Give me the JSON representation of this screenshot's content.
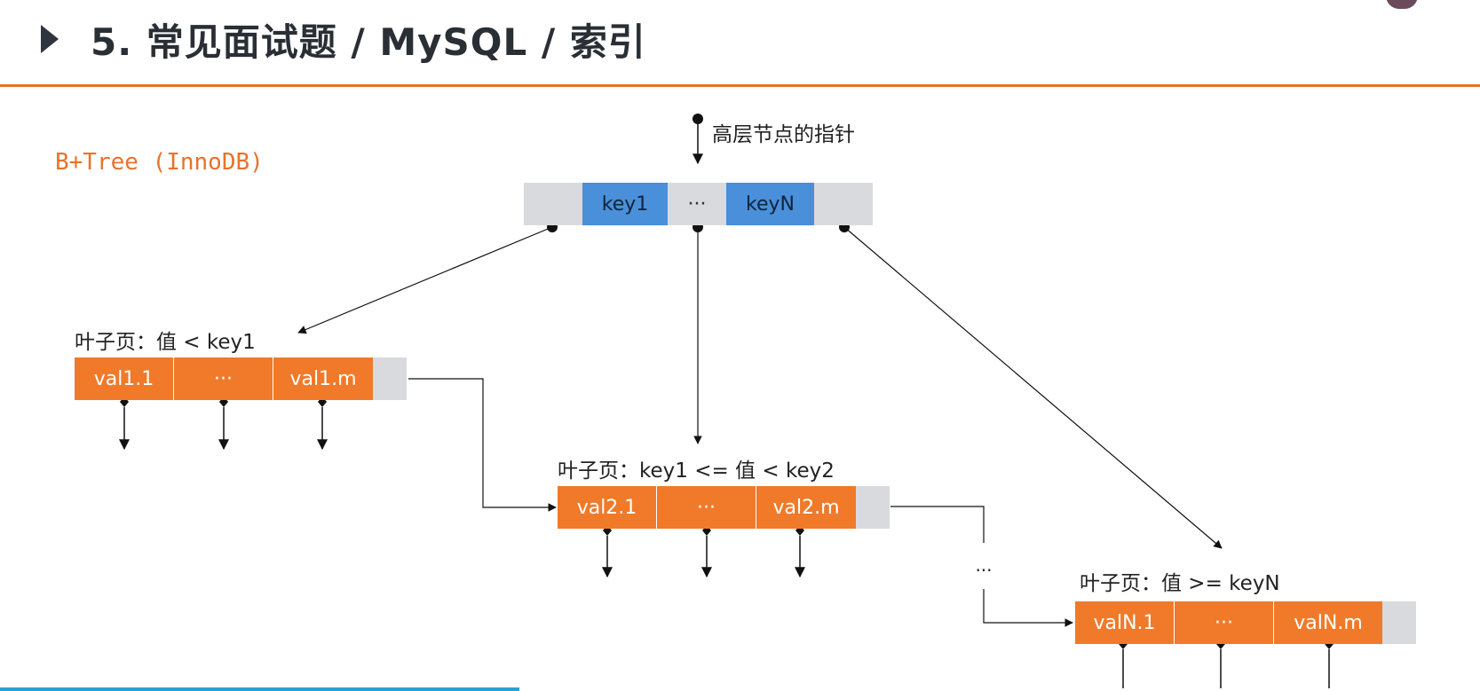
{
  "header": {
    "title": "5. 常见面试题 / MySQL / 索引"
  },
  "subtitle": "B+Tree (InnoDB)",
  "root": {
    "pointer_label": "高层节点的指针",
    "keys": [
      "key1",
      "···",
      "keyN"
    ]
  },
  "leaves": [
    {
      "label": "叶子页：值 < key1",
      "values": [
        "val1.1",
        "···",
        "val1.m"
      ]
    },
    {
      "label": "叶子页：key1 <= 值 < key2",
      "values": [
        "val2.1",
        "···",
        "val2.m"
      ]
    },
    {
      "label": "叶子页：值 >= keyN",
      "values": [
        "valN.1",
        "···",
        "valN.m"
      ]
    }
  ],
  "ellipsis": "···",
  "colors": {
    "accent": "#e8722c",
    "leaf_cell": "#f07a2a",
    "key_cell": "#4a8fd9",
    "empty_cell": "#d9dadd"
  }
}
